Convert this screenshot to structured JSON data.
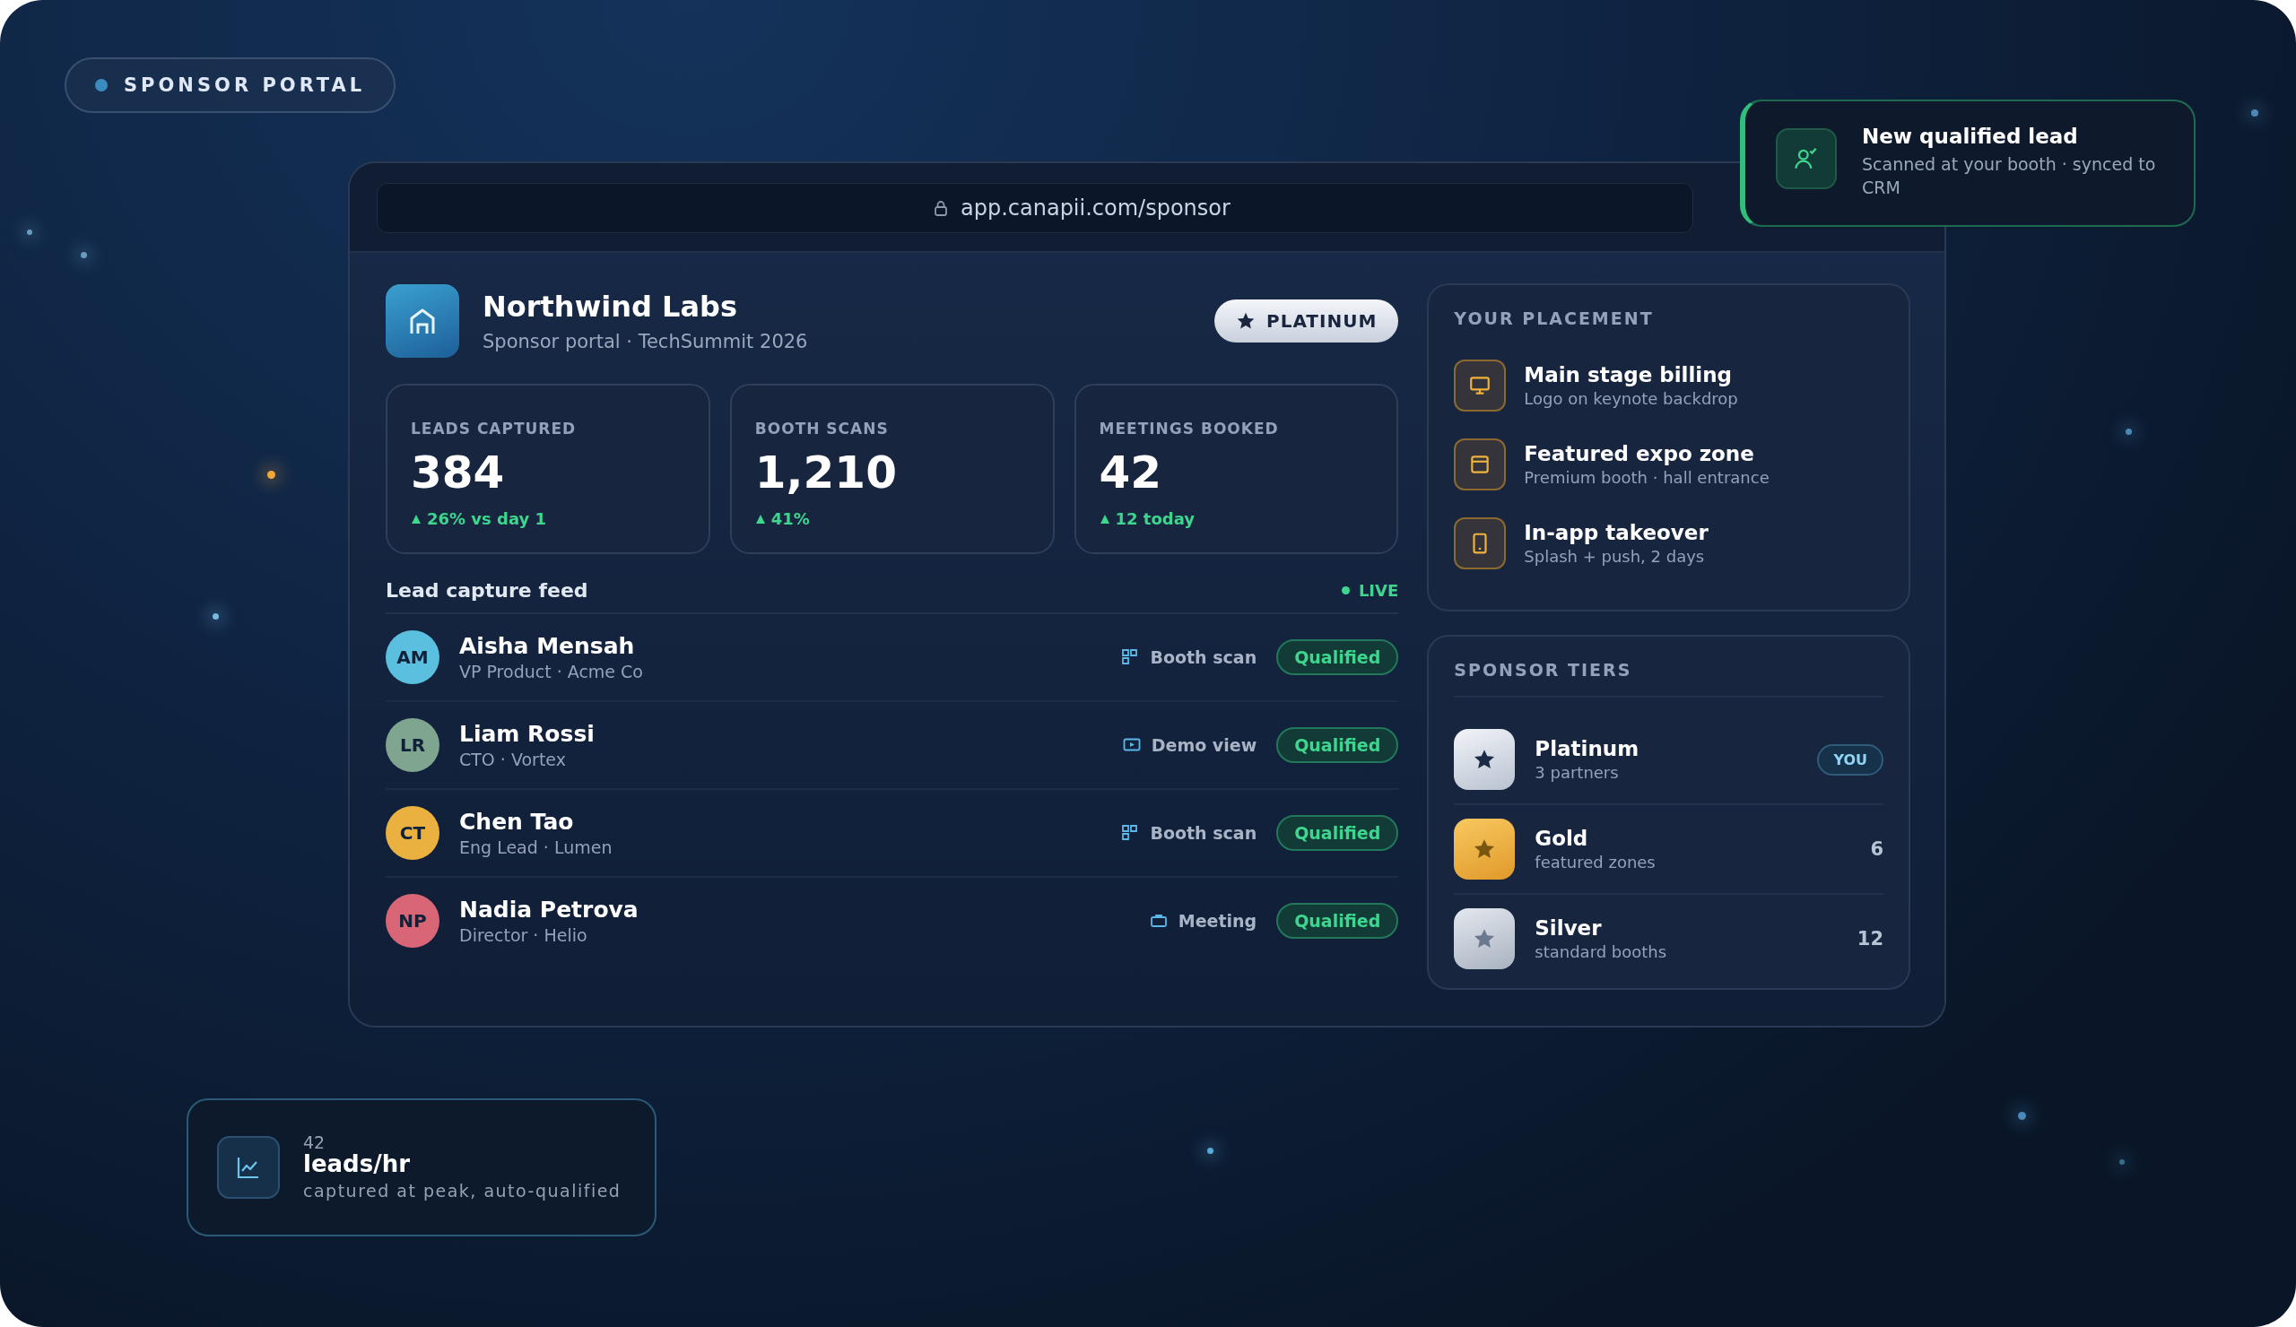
{
  "badge": {
    "label": "SPONSOR PORTAL"
  },
  "browser": {
    "url": "app.canapii.com/sponsor"
  },
  "sponsor": {
    "name": "Northwind Labs",
    "subtitle": "Sponsor portal · TechSummit 2026",
    "tier_badge": "PLATINUM"
  },
  "stats": [
    {
      "label": "LEADS CAPTURED",
      "value": "384",
      "delta": "26% vs day 1"
    },
    {
      "label": "BOOTH SCANS",
      "value": "1,210",
      "delta": "41%"
    },
    {
      "label": "MEETINGS BOOKED",
      "value": "42",
      "delta": "12 today"
    }
  ],
  "feed": {
    "title": "Lead capture feed",
    "status": "LIVE",
    "leads": [
      {
        "initials": "AM",
        "name": "Aisha Mensah",
        "role": "VP Product · Acme Co",
        "color": "#5bbfe0",
        "kind": "scan",
        "source": "Booth scan",
        "status": "Qualified"
      },
      {
        "initials": "LR",
        "name": "Liam Rossi",
        "role": "CTO · Vortex",
        "color": "#7fa48f",
        "kind": "demo",
        "source": "Demo view",
        "status": "Qualified"
      },
      {
        "initials": "CT",
        "name": "Chen Tao",
        "role": "Eng Lead · Lumen",
        "color": "#eab040",
        "kind": "scan",
        "source": "Booth scan",
        "status": "Qualified"
      },
      {
        "initials": "NP",
        "name": "Nadia Petrova",
        "role": "Director · Helio",
        "color": "#d86676",
        "kind": "meeting",
        "source": "Meeting",
        "status": "Qualified"
      }
    ]
  },
  "placement": {
    "title": "YOUR PLACEMENT",
    "items": [
      {
        "kind": "stage",
        "title": "Main stage billing",
        "detail": "Logo on keynote backdrop"
      },
      {
        "kind": "zone",
        "title": "Featured expo zone",
        "detail": "Premium booth · hall entrance"
      },
      {
        "kind": "app",
        "title": "In-app takeover",
        "detail": "Splash + push, 2 days"
      }
    ]
  },
  "tiers": {
    "title": "SPONSOR TIERS",
    "items": [
      {
        "kind": "platinum",
        "name": "Platinum",
        "detail": "3 partners",
        "tag": "YOU"
      },
      {
        "kind": "gold",
        "name": "Gold",
        "detail": "featured zones",
        "count": "6"
      },
      {
        "kind": "silver",
        "name": "Silver",
        "detail": "standard booths",
        "count": "12"
      }
    ]
  },
  "toast": {
    "title": "New qualified lead",
    "message": "Scanned at your booth · synced to CRM"
  },
  "rate_card": {
    "value": "42",
    "unit": "leads/hr",
    "caption": "captured at peak, auto-qualified"
  }
}
